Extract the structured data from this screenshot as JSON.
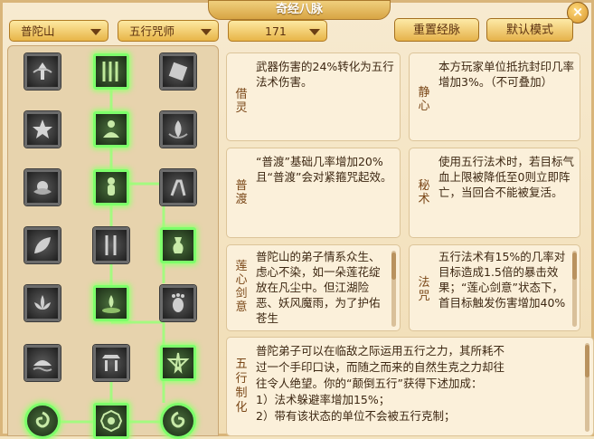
{
  "window": {
    "title": "奇经八脉",
    "close_label": "×"
  },
  "toolbar": {
    "school": "普陀山",
    "build": "五行咒师",
    "points": "171",
    "reset_label": "重置经脉",
    "default_label": "默认模式"
  },
  "cards": [
    {
      "label": "借灵",
      "text": "武器伤害的24%转化为五行法术伤害。"
    },
    {
      "label": "静心",
      "text": "本方玩家单位抵抗封印几率增加3%。（不可叠加）"
    },
    {
      "label": "普渡",
      "text": "“普渡”基础几率增加20%且“普渡”会对紧箍咒起效。"
    },
    {
      "label": "秘术",
      "text": "使用五行法术时，若目标气血上限被降低至0则立即阵亡，当回合不能被复活。"
    },
    {
      "label": "莲心剑意",
      "text": "普陀山的弟子情系众生、虑心不染，如一朵莲花绽放在凡尘中。但江湖险恶、妖风魔雨，为了护佑苍生"
    },
    {
      "label": "法咒",
      "text": "五行法术有15%的几率对目标造成1.5倍的暴击效果；“莲心剑意”状态下，首目标触发伤害增加40%"
    }
  ],
  "bottom": {
    "label": "五行制化",
    "lines": [
      "普陀弟子可以在临敌之际运用五行之力，其所耗不",
      "过一个手印口诀，而随之而来的自然生克之力却往",
      "往令人绝望。你的“颠倒五行”获得下述加成：",
      "1）法术躲避率增加15%；",
      "2）带有该状态的单位不会被五行克制；"
    ]
  },
  "tree": {
    "nodes": [
      {
        "name": "lotus-up-icon",
        "active": false
      },
      {
        "name": "bamboo-forest-icon",
        "active": true
      },
      {
        "name": "stone-wave-icon",
        "active": false
      },
      {
        "name": "burst-star-icon",
        "active": false
      },
      {
        "name": "meditating-figure-icon",
        "active": true
      },
      {
        "name": "flame-lotus-icon",
        "active": false
      },
      {
        "name": "lotus-blossom-icon",
        "active": false
      },
      {
        "name": "guanyin-statue-icon",
        "active": true
      },
      {
        "name": "crane-figure-icon",
        "active": false
      },
      {
        "name": "leaf-blade-icon",
        "active": false
      },
      {
        "name": "bamboo-stalk-icon",
        "active": false
      },
      {
        "name": "incense-vase-icon",
        "active": true
      },
      {
        "name": "lotus-flower-icon",
        "active": false
      },
      {
        "name": "lotus-pond-icon",
        "active": true
      },
      {
        "name": "footprint-icon",
        "active": false
      },
      {
        "name": "cloud-sea-icon",
        "active": false
      },
      {
        "name": "pagoda-gate-icon",
        "active": false
      },
      {
        "name": "pentagram-icon",
        "active": true
      },
      {
        "name": "swirl-orb-left-icon",
        "active": true
      },
      {
        "name": "bagua-icon",
        "active": true
      },
      {
        "name": "swirl-orb-right-icon",
        "active": true
      }
    ]
  }
}
